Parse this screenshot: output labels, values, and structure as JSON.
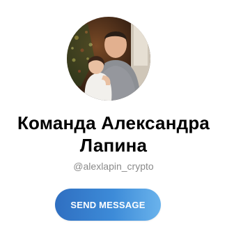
{
  "profile": {
    "name": "Команда Александра Лапина",
    "username": "@alexlapin_crypto",
    "avatar_icon": "profile-photo"
  },
  "actions": {
    "send_message_label": "SEND MESSAGE"
  },
  "colors": {
    "button_gradient_start": "#2f6fc1",
    "button_gradient_end": "#6ab3ec",
    "username": "#8a8a8a",
    "title": "#000000"
  }
}
